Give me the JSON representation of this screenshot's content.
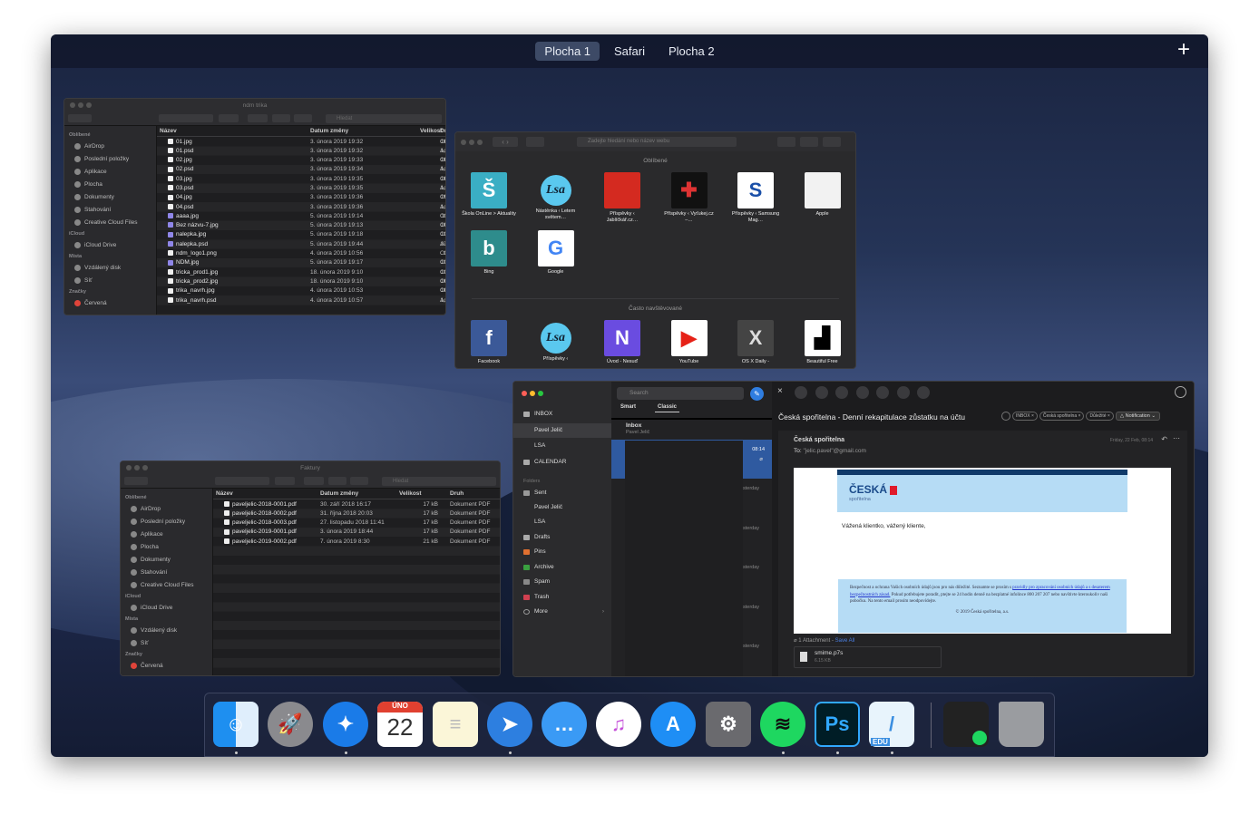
{
  "spaces": {
    "items": [
      "Plocha 1",
      "Safari",
      "Plocha 2"
    ],
    "active": 0,
    "add_label": "+"
  },
  "finder1": {
    "title": "ndm trika",
    "search_placeholder": "Hledat",
    "sidebar": [
      {
        "h": "Oblíbené"
      },
      {
        "i": "AirDrop"
      },
      {
        "i": "Poslední položky"
      },
      {
        "i": "Aplikace"
      },
      {
        "i": "Plocha"
      },
      {
        "i": "Dokumenty"
      },
      {
        "i": "Stahování"
      },
      {
        "i": "Creative Cloud Files"
      },
      {
        "h": "iCloud"
      },
      {
        "i": "iCloud Drive"
      },
      {
        "h": "Místa"
      },
      {
        "i": "Vzdálený disk"
      },
      {
        "i": "Síť"
      },
      {
        "h": "Značky"
      },
      {
        "i": "Červená"
      }
    ],
    "columns": [
      "Název",
      "Datum změny",
      "Velikost",
      "Dr"
    ],
    "rows": [
      [
        "01.jpg",
        "3. února 2019 19:32",
        "182 kB",
        "Ot"
      ],
      [
        "01.psd",
        "3. února 2019 19:32",
        "1,7 MB",
        "Ad"
      ],
      [
        "02.jpg",
        "3. února 2019 19:33",
        "182 kB",
        "Ot"
      ],
      [
        "02.psd",
        "3. února 2019 19:34",
        "1,7 MB",
        "Ad"
      ],
      [
        "03.jpg",
        "3. února 2019 19:35",
        "181 kB",
        "Ot"
      ],
      [
        "03.psd",
        "3. února 2019 19:35",
        "1,7 MB",
        "Ad"
      ],
      [
        "04.jpg",
        "3. února 2019 19:36",
        "194 kB",
        "Ot"
      ],
      [
        "04.psd",
        "3. února 2019 19:36",
        "1,8 MB",
        "Ad"
      ],
      [
        "aaaa.jpg",
        "5. února 2019 19:14",
        "117 kB",
        "Ot"
      ],
      [
        "Bez názvu-7.jpg",
        "5. února 2019 19:13",
        "100 kB",
        "Ot"
      ],
      [
        "nalepka.jpg",
        "5. února 2019 19:18",
        "127 kB",
        "Ot"
      ],
      [
        "nalepka.psd",
        "5. února 2019 19:44",
        "374 kB",
        "Ad"
      ],
      [
        "ndm_logo1.png",
        "4. února 2019 10:56",
        "25 kB",
        "Ot"
      ],
      [
        "NDM.jpg",
        "5. února 2019 19:17",
        "130 kB",
        "Ot"
      ],
      [
        "tricka_prod1.jpg",
        "18. února 2019 9:10",
        "136 kB",
        "Ot"
      ],
      [
        "tricka_prod2.jpg",
        "18. února 2019 9:10",
        "165 kB",
        "Ot"
      ],
      [
        "trika_navrh.jpg",
        "4. února 2019 10:53",
        "183 kB",
        "Ot"
      ],
      [
        "trika_navrh.psd",
        "4. února 2019 10:57",
        "1,7 MB",
        "Ad"
      ]
    ]
  },
  "finder2": {
    "title": "Faktury",
    "search_placeholder": "Hledat",
    "sidebar": [
      {
        "h": "Oblíbené"
      },
      {
        "i": "AirDrop"
      },
      {
        "i": "Poslední položky"
      },
      {
        "i": "Aplikace"
      },
      {
        "i": "Plocha"
      },
      {
        "i": "Dokumenty"
      },
      {
        "i": "Stahování"
      },
      {
        "i": "Creative Cloud Files"
      },
      {
        "h": "iCloud"
      },
      {
        "i": "iCloud Drive"
      },
      {
        "h": "Místa"
      },
      {
        "i": "Vzdálený disk"
      },
      {
        "i": "Síť"
      },
      {
        "h": "Značky"
      },
      {
        "i": "Červená"
      }
    ],
    "columns": [
      "Název",
      "Datum změny",
      "Velikost",
      "Druh"
    ],
    "rows": [
      [
        "paveljelic-2018-0001.pdf",
        "30. září 2018 16:17",
        "17 kB",
        "Dokument PDF"
      ],
      [
        "paveljelic-2018-0002.pdf",
        "31. října 2018 20:03",
        "17 kB",
        "Dokument PDF"
      ],
      [
        "paveljelic-2018-0003.pdf",
        "27. listopadu 2018 11:41",
        "17 kB",
        "Dokument PDF"
      ],
      [
        "paveljelic-2019-0001.pdf",
        "3. února 2019 18:44",
        "17 kB",
        "Dokument PDF"
      ],
      [
        "paveljelic-2019-0002.pdf",
        "7. února 2019 8:30",
        "21 kB",
        "Dokument PDF"
      ]
    ]
  },
  "safari": {
    "address_placeholder": "Zadejte hledání nebo název webu",
    "favorites_title": "Oblíbené",
    "frequent_title": "Často navštěvované",
    "favorites": [
      {
        "label": "Škola OnLine > Aktuality",
        "glyph": "Š",
        "bg": "#3aaec4",
        "fg": "#fff"
      },
      {
        "label": "Nástěnka ‹ Letem světem…",
        "glyph": "Lsa",
        "bg": "#5ac8ef",
        "fg": "#123",
        "round": true
      },
      {
        "label": "Příspěvky ‹ Jablíčkář.cz…",
        "glyph": "",
        "bg": "#d42a20",
        "fg": "#fff"
      },
      {
        "label": "Příspěvky ‹ Vyťukej.cz –…",
        "glyph": "✚",
        "bg": "#111",
        "fg": "#d33"
      },
      {
        "label": "Příspěvky ‹ Samsung Mag…",
        "glyph": "S",
        "bg": "#fff",
        "fg": "#1a4fa8"
      },
      {
        "label": "Apple",
        "glyph": "",
        "bg": "#f2f2f2",
        "fg": "#777"
      },
      {
        "label": "Bing",
        "glyph": "b",
        "bg": "#2e8c8c",
        "fg": "#fff"
      },
      {
        "label": "Google",
        "glyph": "G",
        "bg": "#fff",
        "fg": "#4285f4"
      }
    ],
    "frequent": [
      {
        "label": "Facebook",
        "glyph": "f",
        "bg": "#3b5998",
        "fg": "#fff"
      },
      {
        "label": "Příspěvky ‹",
        "glyph": "Lsa",
        "bg": "#5ac8ef",
        "fg": "#123",
        "round": true
      },
      {
        "label": "Úvod - Nesuď",
        "glyph": "N",
        "bg": "#6a4ce0",
        "fg": "#fff"
      },
      {
        "label": "YouTube",
        "glyph": "▶",
        "bg": "#fff",
        "fg": "#e62117"
      },
      {
        "label": "OS X Daily -",
        "glyph": "X",
        "bg": "#444",
        "fg": "#ddd"
      },
      {
        "label": "Beautiful Free",
        "glyph": "▟",
        "bg": "#fff",
        "fg": "#000"
      }
    ]
  },
  "mail": {
    "sidebar": {
      "inbox": "INBOX",
      "inbox_accounts": [
        "Pavel Jelič",
        "LSA"
      ],
      "calendar": "CALENDAR",
      "folders_label": "Folders",
      "sent": "Sent",
      "sent_accounts": [
        "Pavel Jelič",
        "LSA"
      ],
      "folders": [
        {
          "label": "Drafts",
          "color": "#aaa"
        },
        {
          "label": "Pins",
          "color": "#e07030"
        },
        {
          "label": "Archive",
          "color": "#3aa040"
        },
        {
          "label": "Spam",
          "color": "#888"
        },
        {
          "label": "Trash",
          "color": "#d04050"
        }
      ],
      "more": "More"
    },
    "list": {
      "search_placeholder": "Search",
      "tabs": [
        "Smart",
        "Classic"
      ],
      "active_tab": 1,
      "inbox_title": "Inbox",
      "inbox_account": "Pavel Jelič",
      "selected_time": "08:14",
      "day_labels": [
        "sterday",
        "sterday",
        "sterday",
        "sterday",
        "sterday"
      ]
    },
    "detail": {
      "subject": "Česká spořitelna - Denní rekapitulace zůstatku na účtu",
      "tags": [
        "INBOX",
        "Česká spořitelna",
        "Důležité"
      ],
      "notification": "Notification",
      "sender": "Česká spořitelna",
      "to_label": "To:",
      "to": "\"jelic.pavel\"@gmail.com",
      "date": "Friday, 22 Feb, 08:14",
      "logo_main": "ČESKÁ",
      "logo_sub": "spořitelna",
      "greeting": "Vážená klientko, vážený kliente,",
      "footer_text": "Bezpečnost a ochrana Vašich osobních údajů jsou pro nás důležité. Seznamte se prosím s ",
      "footer_link": "pravidly pro zpracování osobních údajů a s desaterem bezpečnostních zásad.",
      "footer_text2": " Pokud potřebujete poradit, ptejte se 24 hodin denně na bezplatné infolince 800 207 207 nebo navštivte kteroukoliv naši pobočku. Na tento email prosím neodpovídejte.",
      "copyright": "© 2019 Česká spořitelna, a.s.",
      "attachments_label": "1 Attachment - ",
      "save_all": "Save All",
      "file_name": "smime.p7s",
      "file_size": "6.15 KB"
    }
  },
  "dock": {
    "calendar_month": "ÚNO",
    "calendar_day": "22",
    "edu_label": "EDU",
    "apps": [
      {
        "name": "finder",
        "bg": "linear-gradient(90deg,#1e8ff0 50%,#dfeefc 50%)",
        "glyph": "☺",
        "running": true
      },
      {
        "name": "launchpad",
        "bg": "#8a8a8e",
        "glyph": "🚀",
        "round": true,
        "running": false
      },
      {
        "name": "safari",
        "bg": "#1a7be8",
        "glyph": "✦",
        "round": true,
        "running": true
      },
      {
        "name": "calendar",
        "bg": "#fff",
        "glyph": "",
        "running": false
      },
      {
        "name": "notes",
        "bg": "#fbf6d8",
        "glyph": "≡",
        "running": false
      },
      {
        "name": "spark",
        "bg": "#2d7fe0",
        "glyph": "➤",
        "round": true,
        "running": true
      },
      {
        "name": "messages",
        "bg": "#3a9af5",
        "glyph": "…",
        "round": true,
        "running": false
      },
      {
        "name": "itunes",
        "bg": "#fff",
        "glyph": "♫",
        "round": true,
        "running": false
      },
      {
        "name": "app-store",
        "bg": "#1e8ef5",
        "glyph": "A",
        "round": true,
        "running": false
      },
      {
        "name": "system-preferences",
        "bg": "#6a6a6e",
        "glyph": "⚙",
        "running": false
      },
      {
        "name": "spotify",
        "bg": "#1ed760",
        "glyph": "≋",
        "round": true,
        "running": true
      },
      {
        "name": "photoshop",
        "bg": "#001d26",
        "glyph": "Ps",
        "running": true
      },
      {
        "name": "archicad",
        "bg": "#e8f4fc",
        "glyph": "/",
        "running": true
      },
      {
        "name": "spotify-window",
        "bg": "#222",
        "glyph": "",
        "running": false
      },
      {
        "name": "trash",
        "bg": "#9a9ca0",
        "glyph": "",
        "running": false
      }
    ]
  }
}
